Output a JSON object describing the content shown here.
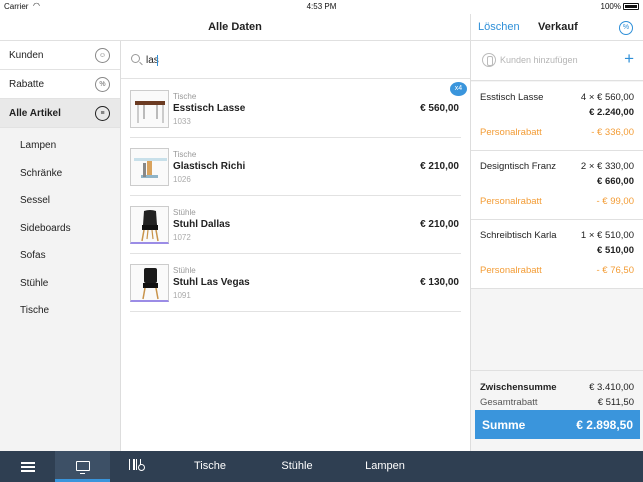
{
  "status_bar": {
    "carrier": "Carrier",
    "time": "4:53 PM",
    "battery": "100%"
  },
  "header": {
    "title": "Alle Daten",
    "delete_label": "Löschen",
    "sale_title": "Verkauf",
    "percent_icon": "percent-icon"
  },
  "sidebar": {
    "items": [
      {
        "label": "Kunden",
        "icon": "customers-icon"
      },
      {
        "label": "Rabatte",
        "icon": "percent-icon"
      },
      {
        "label": "Alle Artikel",
        "icon": "list-icon"
      }
    ],
    "subitems": [
      "Lampen",
      "Schränke",
      "Sessel",
      "Sideboards",
      "Sofas",
      "Stühle",
      "Tische"
    ]
  },
  "search": {
    "value": "las"
  },
  "products": [
    {
      "category": "Tische",
      "name": "Esstisch Lasse",
      "sku": "1033",
      "price": "€ 560,00",
      "badge": "x4"
    },
    {
      "category": "Tische",
      "name": "Glastisch Richi",
      "sku": "1026",
      "price": "€ 210,00"
    },
    {
      "category": "Stühle",
      "name": "Stuhl Dallas",
      "sku": "1072",
      "price": "€ 210,00"
    },
    {
      "category": "Stühle",
      "name": "Stuhl Las Vegas",
      "sku": "1091",
      "price": "€ 130,00"
    }
  ],
  "cart": {
    "customer_placeholder": "Kunden hinzufügen",
    "items": [
      {
        "name": "Esstisch Lasse",
        "qty": "4 × € 560,00",
        "total": "€ 2.240,00",
        "discount_label": "Personalrabatt",
        "discount": "- € 336,00"
      },
      {
        "name": "Designtisch Franz",
        "qty": "2 × € 330,00",
        "total": "€ 660,00",
        "discount_label": "Personalrabatt",
        "discount": "- € 99,00"
      },
      {
        "name": "Schreibtisch Karla",
        "qty": "1 × € 510,00",
        "total": "€ 510,00",
        "discount_label": "Personalrabatt",
        "discount": "- € 76,50"
      }
    ],
    "subtotal_label": "Zwischensumme",
    "subtotal": "€ 3.410,00",
    "discount_total_label": "Gesamtrabatt",
    "discount_total": "€ 511,50",
    "sum_label": "Summe",
    "sum": "€ 2.898,50"
  },
  "bottom_bar": {
    "categories": [
      "Tische",
      "Stühle",
      "Lampen"
    ]
  },
  "colors": {
    "accent": "#3a95dc",
    "discount": "#f39c35",
    "bottom_bar": "#2f3f52"
  }
}
